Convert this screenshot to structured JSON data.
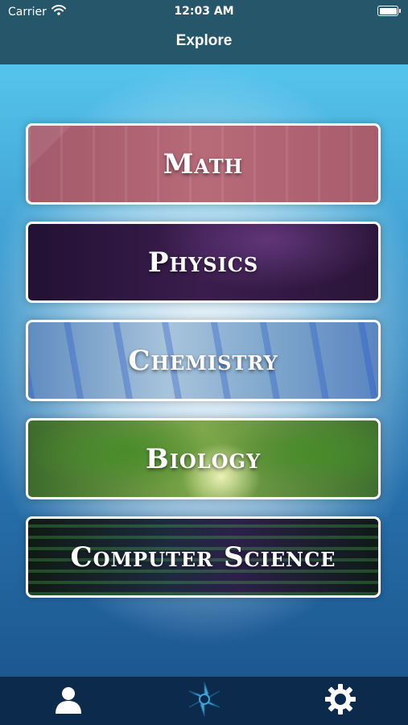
{
  "status": {
    "carrier": "Carrier",
    "time": "12:03 AM"
  },
  "header": {
    "title": "Explore"
  },
  "subjects": [
    {
      "label": "Math"
    },
    {
      "label": "Physics"
    },
    {
      "label": "Chemistry"
    },
    {
      "label": "Biology"
    },
    {
      "label": "Computer Science"
    }
  ],
  "tabbar": {
    "items": [
      {
        "icon": "profile-icon"
      },
      {
        "icon": "app-logo-icon"
      },
      {
        "icon": "settings-gear-icon"
      }
    ]
  },
  "colors": {
    "topbar": "#26566a",
    "tabbar": "#0b2a4c",
    "logo_accent": "#3fa3d6"
  }
}
